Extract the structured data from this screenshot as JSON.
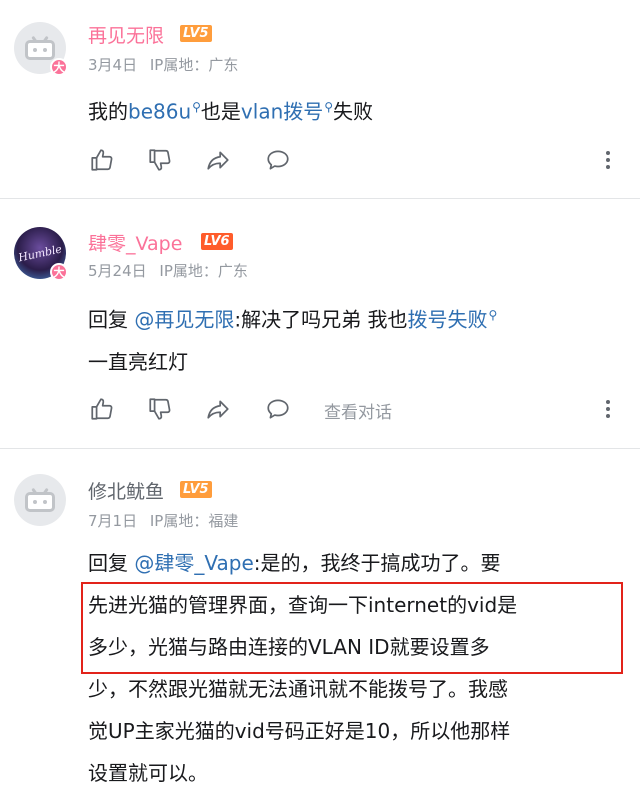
{
  "comments": [
    {
      "username": "再见无限",
      "level": "LV5",
      "date": "3月4日",
      "ip_label": "IP属地：",
      "ip": "广东",
      "content": {
        "t1": "我的",
        "link1": "be86u",
        "t2": "也是",
        "link2": "vlan拨号",
        "t3": "失败"
      }
    },
    {
      "username": "肆零_Vape",
      "level": "LV6",
      "date": "5月24日",
      "ip_label": "IP属地：",
      "ip": "广东",
      "content": {
        "reply_prefix": "回复",
        "mention": "@再见无限",
        "t1": ":解决了吗兄弟 我也",
        "link1": "拨号失败",
        "line2": "一直亮红灯"
      },
      "view_conversation": "查看对话"
    },
    {
      "username": "修北鱿鱼",
      "level": "LV5",
      "date": "7月1日",
      "ip_label": "IP属地：",
      "ip": "福建",
      "content": {
        "reply_prefix": "回复",
        "mention": "@肆零_Vape",
        "t1": ":是的，我终于搞成功了。要",
        "line2": "先进光猫的管理界面，查询一下internet的vid是",
        "line3": "多少，光猫与路由连接的VLAN ID就要设置多",
        "line4": "少，不然跟光猫就无法通讯就不能拨号了。我感",
        "line5": "觉UP主家光猫的vid号码正好是10，所以他那样",
        "line6": "设置就可以。"
      }
    }
  ],
  "badge_big_char": "大",
  "colors": {
    "username": "#fb7299",
    "link": "#2f6fb2",
    "meta": "#9499a0",
    "highlight": "#e2231a"
  }
}
